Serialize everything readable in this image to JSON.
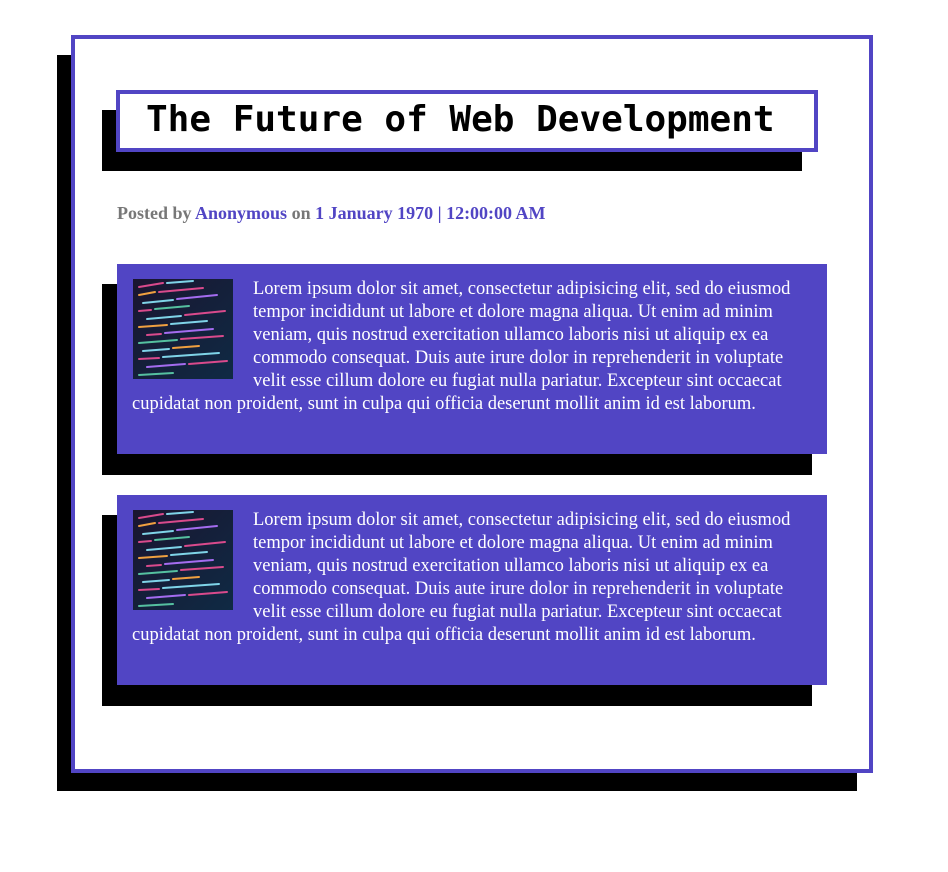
{
  "article": {
    "title": "The Future of Web Development",
    "byline": {
      "posted_by_label": "Posted by",
      "author": "Anonymous",
      "on_label": "on",
      "date": "1 January 1970",
      "separator": "|",
      "time": "12:00:00 AM"
    }
  },
  "posts": [
    {
      "thumbnail_icon": "code-screenshot-thumbnail",
      "text": "Lorem ipsum dolor sit amet, consectetur adipisicing elit, sed do eiusmod tempor incididunt ut labore et dolore magna aliqua. Ut enim ad minim veniam, quis nostrud exercitation ullamco laboris nisi ut aliquip ex ea commodo consequat. Duis aute irure dolor in reprehenderit in voluptate velit esse cillum dolore eu fugiat nulla pariatur. Excepteur sint occaecat cupidatat non proident, sunt in culpa qui officia deserunt mollit anim id est laborum."
    },
    {
      "thumbnail_icon": "code-screenshot-thumbnail",
      "text": "Lorem ipsum dolor sit amet, consectetur adipisicing elit, sed do eiusmod tempor incididunt ut labore et dolore magna aliqua. Ut enim ad minim veniam, quis nostrud exercitation ullamco laboris nisi ut aliquip ex ea commodo consequat. Duis aute irure dolor in reprehenderit in voluptate velit esse cillum dolore eu fugiat nulla pariatur. Excepteur sint occaecat cupidatat non proident, sunt in culpa qui officia deserunt mollit anim id est laborum."
    }
  ],
  "colors": {
    "accent": "#5145c4",
    "shadow": "#000000",
    "byline_gray": "#777777",
    "text_on_accent": "#ffffff"
  }
}
